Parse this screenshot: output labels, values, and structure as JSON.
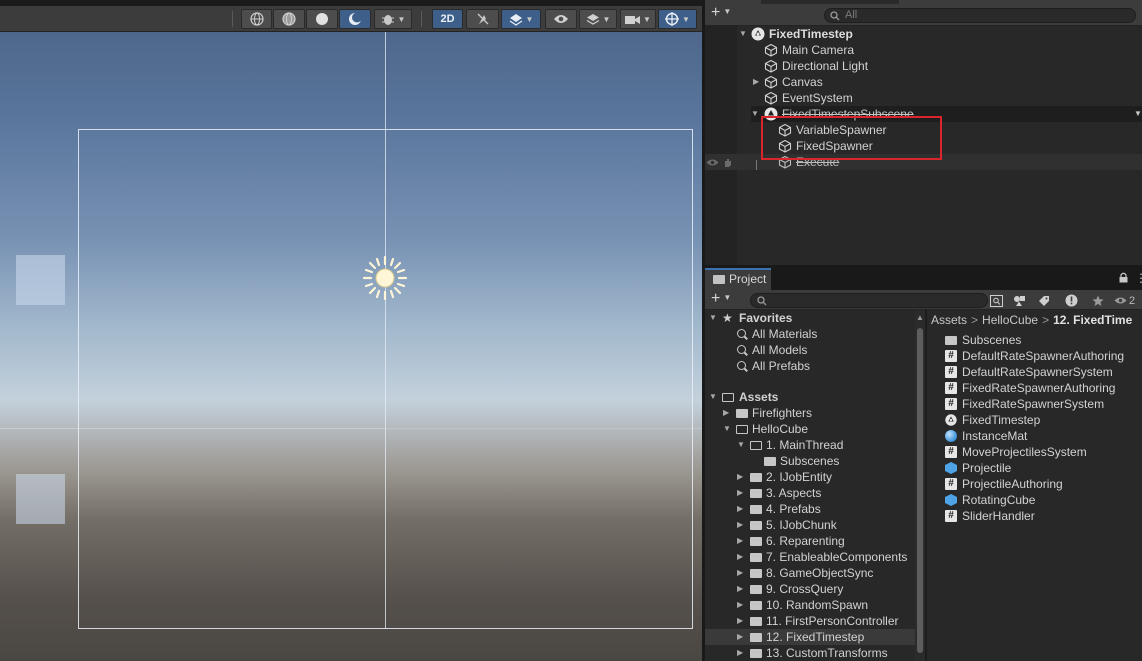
{
  "scene_view": {
    "toolbar": {
      "toggle_2d_label": "2D"
    }
  },
  "hierarchy": {
    "search_placeholder": "All",
    "items": [
      {
        "label": "FixedTimestep"
      },
      {
        "label": "Main Camera"
      },
      {
        "label": "Directional Light"
      },
      {
        "label": "Canvas"
      },
      {
        "label": "EventSystem"
      },
      {
        "label": "FixedTimestepSubscene"
      },
      {
        "label": "VariableSpawner"
      },
      {
        "label": "FixedSpawner"
      },
      {
        "label": "Execute"
      }
    ]
  },
  "project": {
    "tab_label": "Project",
    "hidden_count": "2",
    "favorites": {
      "label": "Favorites",
      "items": [
        "All Materials",
        "All Models",
        "All Prefabs"
      ]
    },
    "assets": {
      "label": "Assets",
      "children": [
        {
          "label": "Firefighters"
        },
        {
          "label": "HelloCube"
        },
        {
          "label": "1. MainThread"
        },
        {
          "label": "Subscenes"
        },
        {
          "label": "2. IJobEntity"
        },
        {
          "label": "3. Aspects"
        },
        {
          "label": "4. Prefabs"
        },
        {
          "label": "5. IJobChunk"
        },
        {
          "label": "6. Reparenting"
        },
        {
          "label": "7. EnableableComponents"
        },
        {
          "label": "8. GameObjectSync"
        },
        {
          "label": "9. CrossQuery"
        },
        {
          "label": "10. RandomSpawn"
        },
        {
          "label": "11. FirstPersonController"
        },
        {
          "label": "12. FixedTimestep"
        },
        {
          "label": "13. CustomTransforms"
        }
      ]
    },
    "breadcrumb": [
      "Assets",
      "HelloCube",
      "12. FixedTime"
    ],
    "breadcrumb_sep": ">",
    "folder_contents": [
      {
        "name": "Subscenes",
        "icon": "folder-icon"
      },
      {
        "name": "DefaultRateSpawnerAuthoring",
        "icon": "script-icon"
      },
      {
        "name": "DefaultRateSpawnerSystem",
        "icon": "script-icon"
      },
      {
        "name": "FixedRateSpawnerAuthoring",
        "icon": "script-icon"
      },
      {
        "name": "FixedRateSpawnerSystem",
        "icon": "script-icon"
      },
      {
        "name": "FixedTimestep",
        "icon": "unity-scene-icon"
      },
      {
        "name": "InstanceMat",
        "icon": "material-icon"
      },
      {
        "name": "MoveProjectilesSystem",
        "icon": "script-icon"
      },
      {
        "name": "Projectile",
        "icon": "prefab-icon"
      },
      {
        "name": "ProjectileAuthoring",
        "icon": "script-icon"
      },
      {
        "name": "RotatingCube",
        "icon": "prefab-icon"
      },
      {
        "name": "SliderHandler",
        "icon": "script-icon"
      }
    ]
  },
  "colors": {
    "accent_blue": "#3e5f8a",
    "highlight_red": "#d8262c",
    "panel_bg": "#282828",
    "toolbar_bg": "#3c3c3c"
  }
}
